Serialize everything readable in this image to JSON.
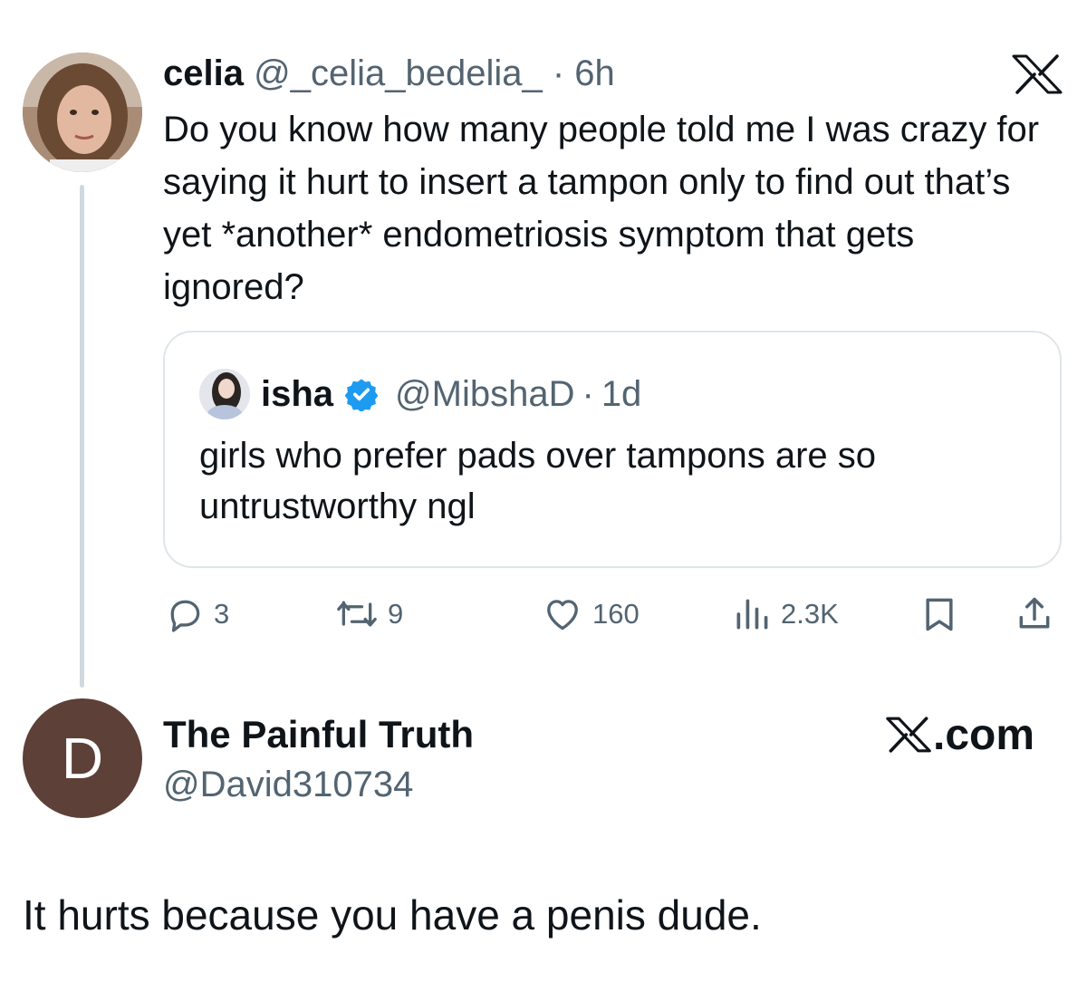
{
  "tweet": {
    "author_name": "celia",
    "author_handle": "@_celia_bedelia_",
    "separator": "·",
    "time": "6h",
    "text": "Do you know how many people told me I was crazy for saying it hurt to insert a tampon only to find out that’s yet *another* endometriosis symptom that gets ignored?",
    "avatar": "profile-photo",
    "platform_icon": "x-logo-icon"
  },
  "quote": {
    "author_name": "isha",
    "verified_icon": "verified-badge-icon",
    "author_handle": "@MibshaD",
    "separator": "·",
    "time": "1d",
    "text": "girls who prefer pads over tampons are so untrustworthy ngl"
  },
  "actions": {
    "replies": "3",
    "reposts": "9",
    "likes": "160",
    "views": "2.3K",
    "icons": [
      "reply-icon",
      "repost-icon",
      "like-icon",
      "views-icon",
      "bookmark-icon",
      "share-icon"
    ]
  },
  "reply": {
    "avatar_letter": "D",
    "author_name": "The Painful Truth",
    "author_handle": "@David310734",
    "site_label": ".com",
    "text": "It hurts because you have a penis dude."
  },
  "colors": {
    "text_primary": "#0f1419",
    "text_secondary": "#536471",
    "border": "#dfe5e9",
    "verified": "#1d9bf0",
    "avatar_d_bg": "#5d4037"
  }
}
